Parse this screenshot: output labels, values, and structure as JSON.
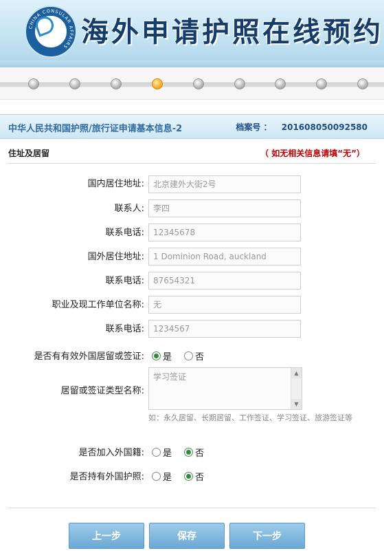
{
  "banner": {
    "title": "海外申请护照在线预约",
    "emblem_ring_text": "CHINA CONSULAR AFFAIRS",
    "emblem_icon": "consular-emblem"
  },
  "progress": {
    "total_steps": 9,
    "current_step": 5
  },
  "form": {
    "title": "中华人民共和国护照/旅行证申请基本信息-2",
    "file_no_label": "档案号 ：",
    "file_no": "201608050092580",
    "section": "住址及居留",
    "notice": "（ 如无相关信息请填“无”）",
    "fields": [
      {
        "label": "国内居住地址:",
        "value": "北京建外大街2号"
      },
      {
        "label": "联系人:",
        "value": "李四"
      },
      {
        "label": "联系电话:",
        "value": "12345678"
      },
      {
        "label": "国外居住地址:",
        "value": "1 Dominion Road, auckland"
      },
      {
        "label": "联系电话:",
        "value": "87654321"
      },
      {
        "label": "职业及现工作单位名称:",
        "value": "无"
      },
      {
        "label": "联系电话:",
        "value": "1234567"
      }
    ],
    "residence_visa": {
      "label": "是否有有效外国居留或签证:",
      "yes": "是",
      "no": "否",
      "selected": "yes"
    },
    "visa_type": {
      "label": "居留或签证类型名称:",
      "value": "学习签证",
      "hint": "如：永久居留、长期居留、工作签证、学习签证、旅游签证等"
    },
    "foreign_nationality": {
      "label": "是否加入外国籍:",
      "yes": "是",
      "no": "否",
      "selected": "no"
    },
    "foreign_passport": {
      "label": "是否持有外国护照:",
      "yes": "是",
      "no": "否",
      "selected": "no"
    }
  },
  "buttons": {
    "prev": "上一步",
    "save": "保存",
    "next": "下一步"
  },
  "colors": {
    "accent": "#2f6aa3",
    "notice": "#c00000",
    "button": "#6aa8d6",
    "active_step": "#f2a318"
  }
}
